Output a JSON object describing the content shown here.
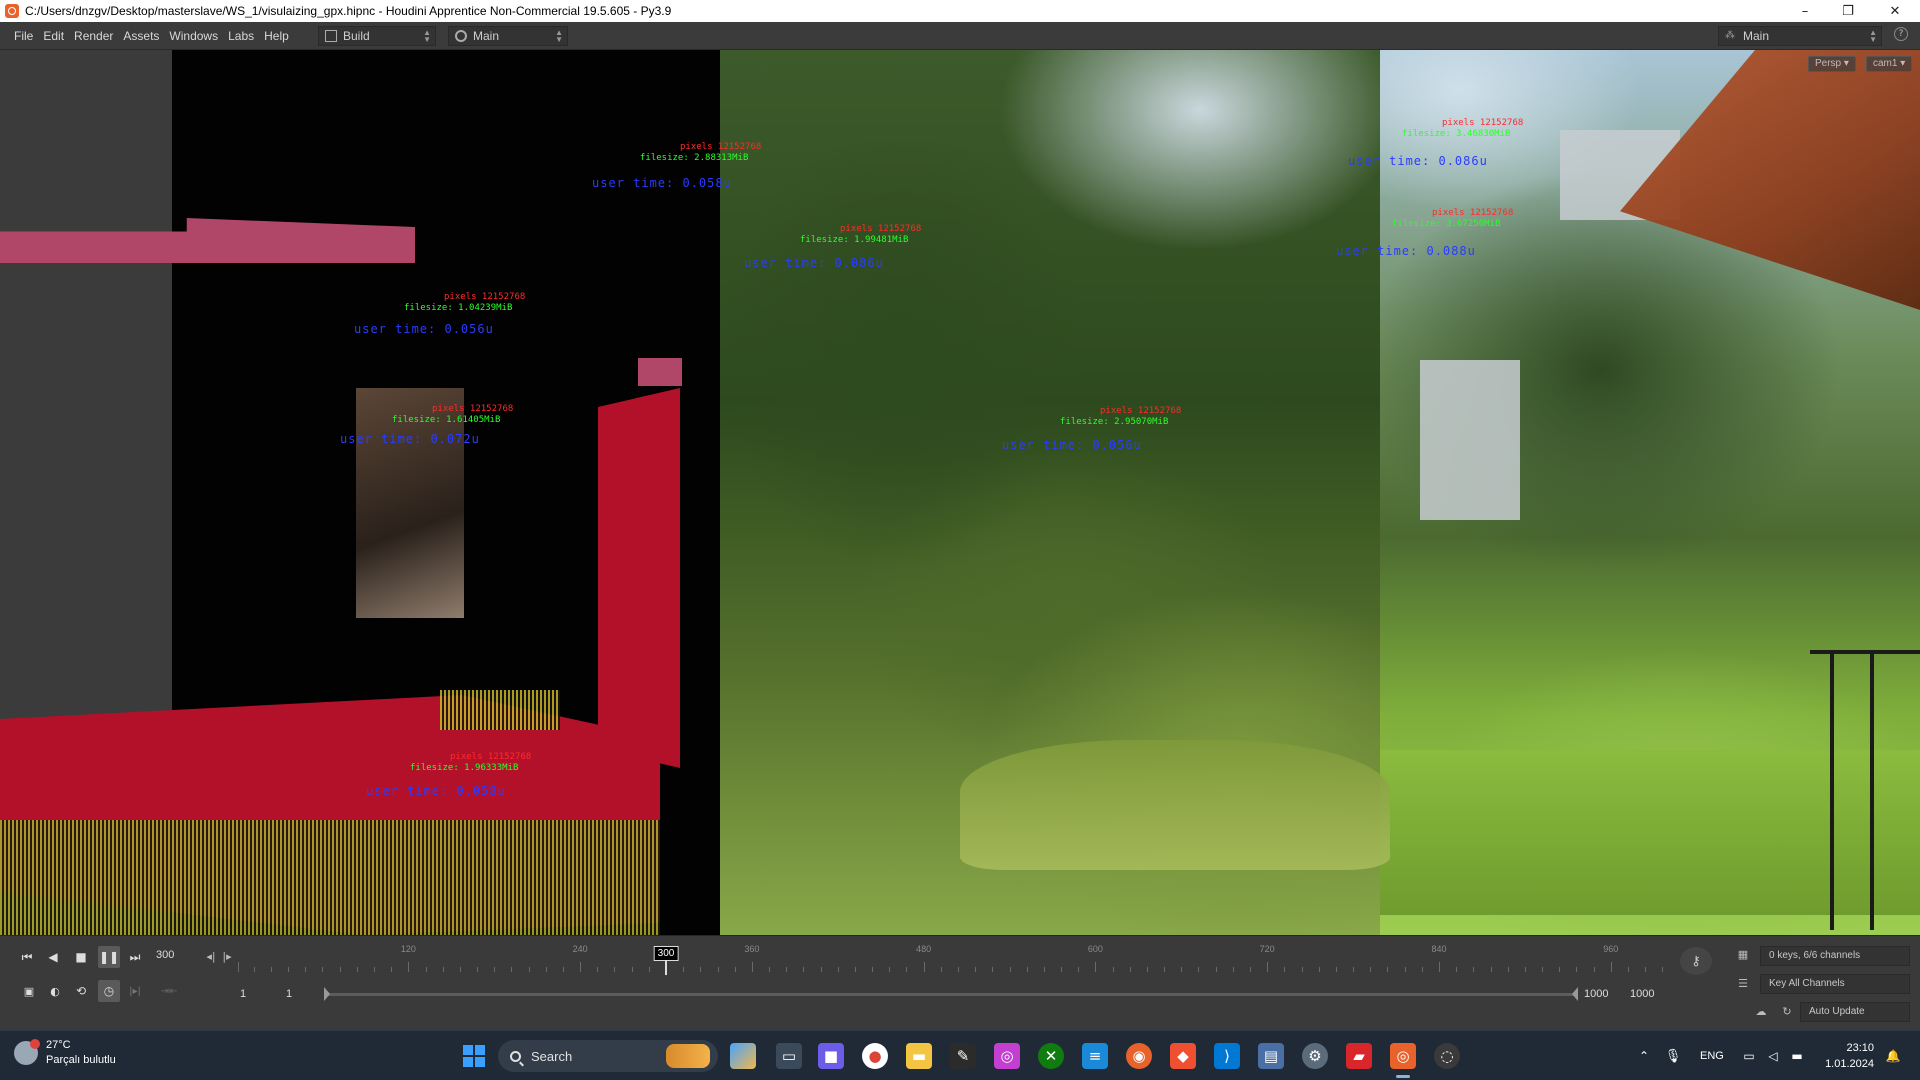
{
  "window": {
    "title": "C:/Users/dnzgv/Desktop/masterslave/WS_1/visulaizing_gpx.hipnc - Houdini Apprentice Non-Commercial 19.5.605 - Py3.9",
    "minimize_icon": "minimize-icon",
    "maximize_icon": "maximize-icon",
    "close_icon": "close-icon"
  },
  "menubar": {
    "items": [
      "File",
      "Edit",
      "Render",
      "Assets",
      "Windows",
      "Labs",
      "Help"
    ],
    "build_desktop": "Build",
    "main_desktop": "Main",
    "right_desktop": "Main"
  },
  "viewport": {
    "persp_label": "Persp ▾",
    "cam_label": "cam1 ▾",
    "annotations": [
      {
        "pixels": "pixels  12152768",
        "filesize": "filesize: 2.88313MiB",
        "usertime": "user time: 0.058u"
      },
      {
        "pixels": "pixels  12152768",
        "filesize": "filesize: 1.99481MiB",
        "usertime": "user time: 0.086u"
      },
      {
        "pixels": "pixels  12152768",
        "filesize": "filesize: 1.04239MiB",
        "usertime": "user time: 0.056u"
      },
      {
        "pixels": "pixels  12152768",
        "filesize: 1.61405MiB": "",
        "filesize": "filesize: 1.61405MiB",
        "usertime": "user time: 0.072u"
      },
      {
        "pixels": "pixels  12152768",
        "filesize": "filesize: 3.46830MiB",
        "usertime": "user time: 0.086u"
      },
      {
        "pixels": "pixels  12152768",
        "filesize": "filesize: 3.67250MiB",
        "usertime": "user time: 0.088u"
      },
      {
        "pixels": "pixels  12152768",
        "filesize": "filesize: 2.95070MiB",
        "usertime": "user time: 0.056u"
      },
      {
        "pixels": "pixels  12152768",
        "filesize": "filesize: 1.96333MiB",
        "usertime": "user time: 0.058u"
      }
    ]
  },
  "timeline": {
    "current_frame": "300",
    "marker_frame": "300",
    "ruler_labels": [
      "120",
      "240",
      "360",
      "480",
      "600",
      "720",
      "840",
      "960"
    ],
    "start_frame": "1",
    "start_frame_2": "1",
    "end_frame": "1000",
    "end_frame_2": "1000",
    "keys_channels": "0 keys, 6/6 channels",
    "key_all_channels": "Key All Channels",
    "auto_update": "Auto Update"
  },
  "taskbar": {
    "temperature": "27°C",
    "weather_desc": "Parçalı bulutlu",
    "search_placeholder": "Search",
    "language": "ENG",
    "time": "23:10",
    "date": "1.01.2024"
  },
  "colors": {
    "annotation_red": "#ff2b2b",
    "annotation_green": "#2bff2b",
    "annotation_blue": "#2a3cff",
    "plane_red": "#b3112a"
  }
}
